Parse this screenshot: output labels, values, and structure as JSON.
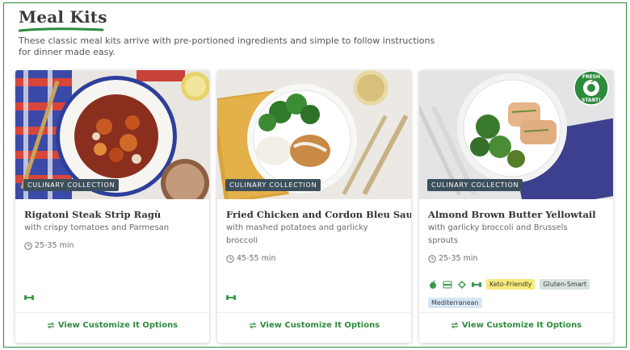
{
  "header": {
    "title": "Meal Kits",
    "subtitle": "These classic meal kits arrive with pre-portioned ingredients and simple to follow instructions for dinner made easy."
  },
  "colors": {
    "brand_green": "#2e8b3e",
    "badge_bg": "#3d4f5c",
    "keto_tag": "#f6ea7a",
    "gluten_tag": "#d7e2de",
    "mediterranean_tag": "#d6e6f6"
  },
  "cards": [
    {
      "collection": "CULINARY COLLECTION",
      "name": "Rigatoni Steak Strip Ragù",
      "description": "with crispy tomatoes and Parmesan",
      "time": "25-35 min",
      "icons": [
        "dumbbell-icon"
      ],
      "link": "View Customize It Options"
    },
    {
      "collection": "CULINARY COLLECTION",
      "name": "Fried Chicken and Cordon Bleu Sauce",
      "description": "with mashed potatoes and garlicky broccoli",
      "time": "45-55 min",
      "icons": [
        "dumbbell-icon"
      ],
      "link": "View Customize It Options"
    },
    {
      "collection": "CULINARY COLLECTION",
      "name": "Almond Brown Butter Yellowtail",
      "description": "with garlicky broccoli and Brussels sprouts",
      "time": "25-35 min",
      "icons": [
        "apple-icon",
        "card-icon",
        "gear-icon",
        "dumbbell-icon"
      ],
      "tags": [
        "Keto-Friendly",
        "Gluten-Smart",
        "Mediterranean"
      ],
      "badge": "FRESH START",
      "link": "View Customize It Options"
    }
  ]
}
